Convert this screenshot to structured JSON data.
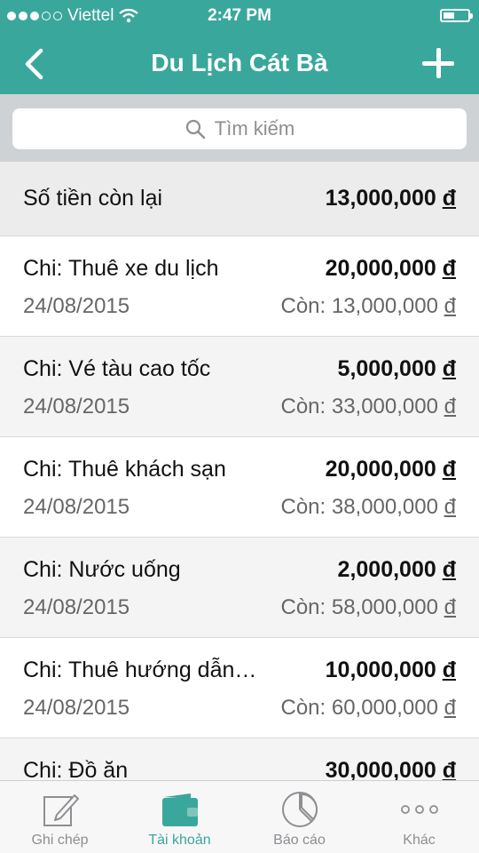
{
  "status_bar": {
    "carrier": "Viettel",
    "time": "2:47 PM"
  },
  "nav": {
    "title": "Du Lịch Cát Bà"
  },
  "search": {
    "placeholder": "Tìm kiếm"
  },
  "summary": {
    "label": "Số tiền còn lại",
    "amount": "13,000,000",
    "currency": "đ"
  },
  "transactions": [
    {
      "name": "Chi: Thuê xe du lịch",
      "amount": "20,000,000",
      "date": "24/08/2015",
      "remaining": "Còn: 13,000,000"
    },
    {
      "name": "Chi: Vé tàu cao tốc",
      "amount": "5,000,000",
      "date": "24/08/2015",
      "remaining": "Còn: 33,000,000"
    },
    {
      "name": "Chi: Thuê khách sạn",
      "amount": "20,000,000",
      "date": "24/08/2015",
      "remaining": "Còn: 38,000,000"
    },
    {
      "name": "Chi: Nước uống",
      "amount": "2,000,000",
      "date": "24/08/2015",
      "remaining": "Còn: 58,000,000"
    },
    {
      "name": "Chi: Thuê hướng dẫn…",
      "amount": "10,000,000",
      "date": "24/08/2015",
      "remaining": "Còn: 60,000,000"
    },
    {
      "name": "Chi: Đồ ăn",
      "amount": "30,000,000",
      "date": "",
      "remaining": ""
    }
  ],
  "currency_symbol": "đ",
  "tabs": [
    {
      "label": "Ghi chép",
      "icon": "edit-icon"
    },
    {
      "label": "Tài khoản",
      "icon": "wallet-icon"
    },
    {
      "label": "Báo cáo",
      "icon": "pie-chart-icon"
    },
    {
      "label": "Khác",
      "icon": "more-icon"
    }
  ],
  "colors": {
    "accent": "#3aa79c",
    "tab_inactive": "#8e8e93"
  }
}
